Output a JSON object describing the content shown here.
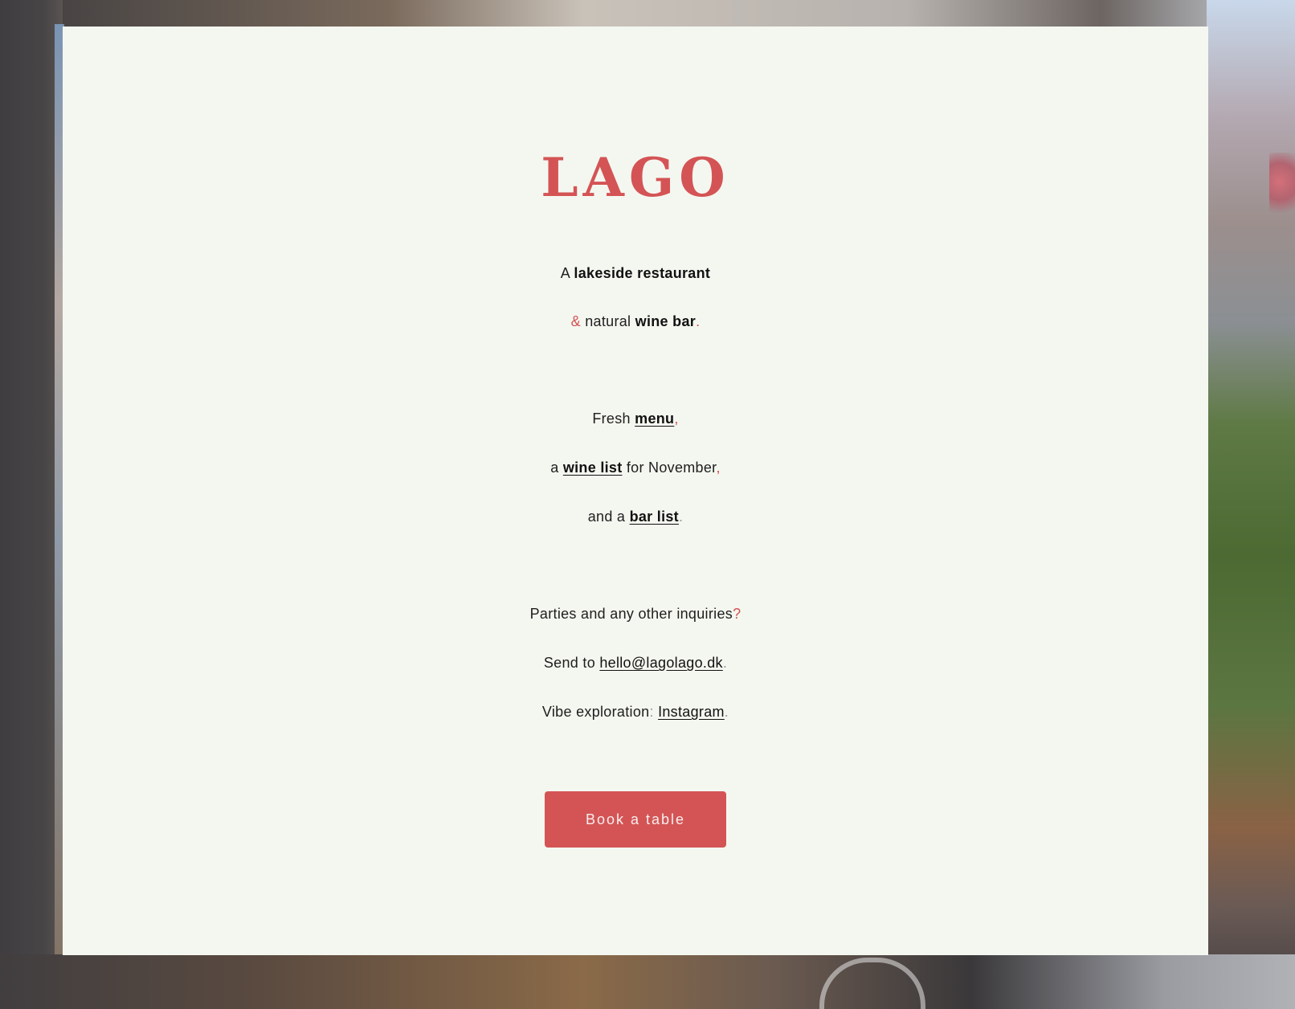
{
  "brand": {
    "logo_text": "LAGO",
    "accent_color": "#d45455",
    "card_background": "#f4f7f0"
  },
  "intro": {
    "line1_prefix": "A ",
    "line1_bold": "lakeside restaurant",
    "line2_amp": "&",
    "line2_mid": " natural ",
    "line2_bold": "wine bar",
    "line2_end": "."
  },
  "offerings": {
    "line1_prefix": "Fresh ",
    "menu_link": "menu",
    "line1_end": ",",
    "line2_prefix": "a ",
    "wine_list_link": "wine list",
    "line2_mid": " for November",
    "line2_end": ",",
    "line3_prefix": "and a ",
    "bar_list_link": "bar list",
    "line3_end": "."
  },
  "contact": {
    "inquiries_text": "Parties and any other inquiries",
    "inquiries_end": "?",
    "send_prefix": "Send to ",
    "email_link": "hello@lagolago.dk",
    "send_end": ".",
    "vibe_prefix": "Vibe exploration",
    "vibe_colon": ":",
    "instagram_link": "Instagram",
    "vibe_end": "."
  },
  "cta": {
    "book_label": "Book a table"
  }
}
